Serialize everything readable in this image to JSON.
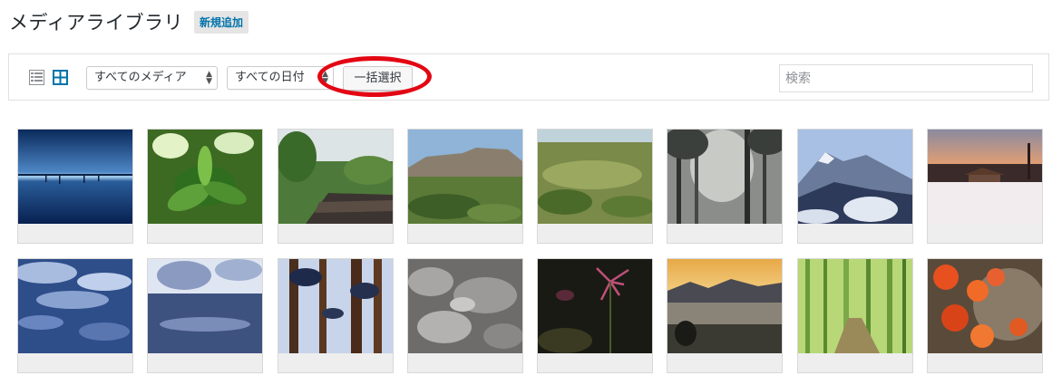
{
  "header": {
    "title": "メディアライブラリ",
    "add_new_label": "新規追加"
  },
  "toolbar": {
    "view_modes": [
      {
        "icon": "list-view-icon",
        "active": false
      },
      {
        "icon": "grid-view-icon",
        "active": true
      }
    ],
    "media_filter": {
      "selected": "すべてのメディア"
    },
    "date_filter": {
      "selected": "すべての日付"
    },
    "bulk_select_label": "一括選択",
    "search": {
      "placeholder": "検索",
      "value": ""
    }
  },
  "colors": {
    "accent": "#0073aa",
    "highlight_ring": "#e30613"
  },
  "media": [
    {
      "name": "night-lake-reflection"
    },
    {
      "name": "tropical-leaves"
    },
    {
      "name": "jungle-river"
    },
    {
      "name": "table-mountain-landscape"
    },
    {
      "name": "green-plain-aerial"
    },
    {
      "name": "misty-forest"
    },
    {
      "name": "snowy-mountains"
    },
    {
      "name": "snowy-cabin-sunset"
    },
    {
      "name": "frozen-marsh"
    },
    {
      "name": "snowy-riverbank"
    },
    {
      "name": "snowy-cedar-forest"
    },
    {
      "name": "frost-texture"
    },
    {
      "name": "red-spider-lily"
    },
    {
      "name": "misty-valley-sunrise"
    },
    {
      "name": "bamboo-grove"
    },
    {
      "name": "autumn-maple-leaves"
    }
  ]
}
